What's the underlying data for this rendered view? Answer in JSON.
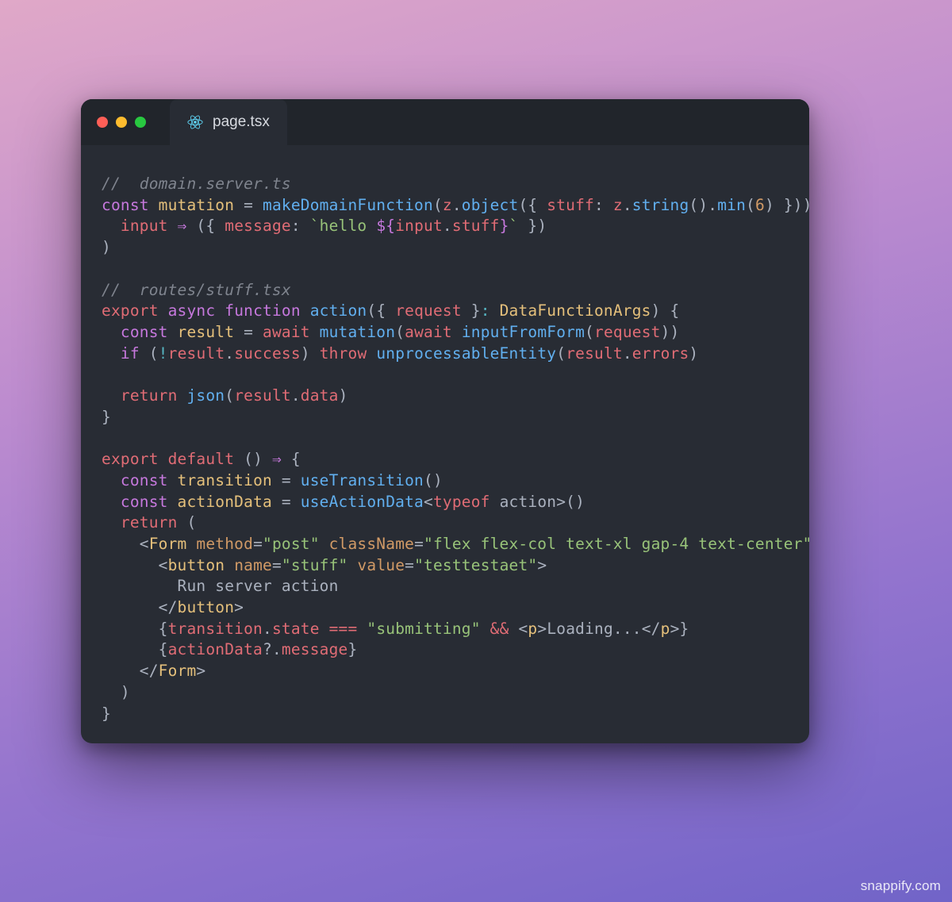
{
  "window": {
    "tab": {
      "icon_name": "react-icon",
      "label": "page.tsx"
    },
    "traffic_lights": [
      "close",
      "minimize",
      "zoom"
    ]
  },
  "code": {
    "comment1": "//  domain.server.ts",
    "l1": {
      "const": "const",
      "mutation": "mutation",
      "eq": " = ",
      "makeDomainFunction": "makeDomainFunction",
      "p1": "(",
      "z1": "z",
      "dot1": ".",
      "object": "object",
      "p2": "({ ",
      "stuff": "stuff",
      "colon": ": ",
      "z2": "z",
      "dot2": ".",
      "string": "string",
      "p3": "().",
      "min": "min",
      "p4": "(",
      "six": "6",
      "p5": ") }))("
    },
    "l2": {
      "indent": "  ",
      "input": "input",
      "arrow": " ⇒ ",
      "open": "({ ",
      "message": "message",
      "colon": ": ",
      "tpl_open": "`hello ",
      "interp_open": "${",
      "input2": "input",
      "dot": ".",
      "stuff": "stuff",
      "interp_close": "}",
      "tpl_close": "`",
      "close": " })"
    },
    "l3": ")",
    "blank1": "",
    "comment2": "//  routes/stuff.tsx",
    "l4": {
      "export": "export",
      "async": "async",
      "function": "function",
      "action": "action",
      "open": "({ ",
      "request": "request",
      "close": " }",
      "colon": ": ",
      "type": "DataFunctionArgs",
      "end": ") {"
    },
    "l5": {
      "indent": "  ",
      "const": "const",
      "sp": " ",
      "result": "result",
      "eq": " = ",
      "await1": "await",
      "sp2": " ",
      "mutation": "mutation",
      "p1": "(",
      "await2": "await",
      "sp3": " ",
      "inputFromForm": "inputFromForm",
      "p2": "(",
      "request": "request",
      "p3": "))"
    },
    "l6": {
      "indent": "  ",
      "if": "if",
      "sp": " (",
      "not": "!",
      "result": "result",
      "dot": ".",
      "success": "success",
      "close": ") ",
      "throw": "throw",
      "sp2": " ",
      "unprocessableEntity": "unprocessableEntity",
      "p1": "(",
      "result2": "result",
      "dot2": ".",
      "errors": "errors",
      "p2": ")"
    },
    "blank2": "",
    "l7": {
      "indent": "  ",
      "return": "return",
      "sp": " ",
      "json": "json",
      "p1": "(",
      "result": "result",
      "dot": ".",
      "data": "data",
      "p2": ")"
    },
    "l8": "}",
    "blank3": "",
    "l9": {
      "export": "export",
      "sp": " ",
      "default": "default",
      "sp2": " () ",
      "arrow": "⇒",
      "sp3": " {"
    },
    "l10": {
      "indent": "  ",
      "const": "const",
      "sp": " ",
      "transition": "transition",
      "eq": " = ",
      "useTransition": "useTransition",
      "p": "()"
    },
    "l11": {
      "indent": "  ",
      "const": "const",
      "sp": " ",
      "actionData": "actionData",
      "eq": " = ",
      "useActionData": "useActionData",
      "lt": "<",
      "typeof": "typeof",
      "sp2": " ",
      "action": "action",
      "gt": ">()"
    },
    "l12": {
      "indent": "  ",
      "return": "return",
      "sp": " ("
    },
    "l13": {
      "indent": "    <",
      "Form": "Form",
      "sp": " ",
      "method": "method",
      "eq1": "=",
      "post": "\"post\"",
      "sp2": " ",
      "className": "className",
      "eq2": "=",
      "cls": "\"flex flex-col text-xl gap-4 text-center\"",
      "close": ">"
    },
    "l14": {
      "indent": "      <",
      "button": "button",
      "sp": " ",
      "name": "name",
      "eq1": "=",
      "nv": "\"stuff\"",
      "sp2": " ",
      "value": "value",
      "eq2": "=",
      "vv": "\"testtestaet\"",
      "close": ">"
    },
    "l15": {
      "indent": "        ",
      "text": "Run server action"
    },
    "l16": {
      "indent": "      </",
      "button": "button",
      "close": ">"
    },
    "l17": {
      "indent": "      {",
      "transition": "transition",
      "dot": ".",
      "state": "state",
      "sp": " ",
      "eqeq": "===",
      "sp2": " ",
      "submitting": "\"submitting\"",
      "sp3": " ",
      "and": "&&",
      "sp4": " <",
      "p": "p",
      "gt": ">",
      "loading": "Loading...",
      "lt2": "</",
      "p2": "p",
      "gt2": ">}"
    },
    "l18": {
      "indent": "      {",
      "actionData": "actionData",
      "opt": "?.",
      "message": "message",
      "close": "}"
    },
    "l19": {
      "indent": "    </",
      "Form": "Form",
      "close": ">"
    },
    "l20": "  )",
    "l21": "}"
  },
  "watermark": "snappify.com"
}
